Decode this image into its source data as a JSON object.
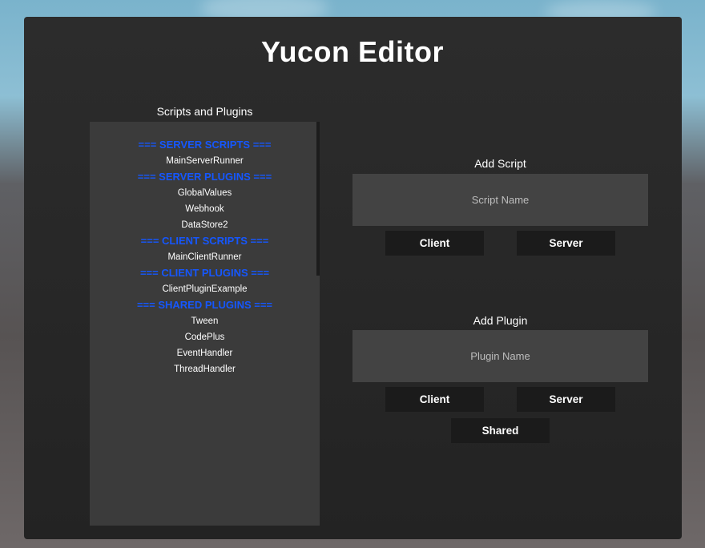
{
  "window": {
    "title": "Yucon Editor"
  },
  "list": {
    "label": "Scripts and Plugins",
    "items": [
      {
        "text": "=== SERVER SCRIPTS ===",
        "header": true
      },
      {
        "text": "MainServerRunner",
        "header": false
      },
      {
        "text": "=== SERVER PLUGINS ===",
        "header": true
      },
      {
        "text": "GlobalValues",
        "header": false
      },
      {
        "text": "Webhook",
        "header": false
      },
      {
        "text": "DataStore2",
        "header": false
      },
      {
        "text": "=== CLIENT SCRIPTS ===",
        "header": true
      },
      {
        "text": "MainClientRunner",
        "header": false
      },
      {
        "text": "=== CLIENT PLUGINS ===",
        "header": true
      },
      {
        "text": "ClientPluginExample",
        "header": false
      },
      {
        "text": "=== SHARED PLUGINS ===",
        "header": true
      },
      {
        "text": "Tween",
        "header": false
      },
      {
        "text": "CodePlus",
        "header": false
      },
      {
        "text": "EventHandler",
        "header": false
      },
      {
        "text": "ThreadHandler",
        "header": false
      }
    ]
  },
  "add_script": {
    "label": "Add Script",
    "placeholder": "Script Name",
    "client_label": "Client",
    "server_label": "Server"
  },
  "add_plugin": {
    "label": "Add Plugin",
    "placeholder": "Plugin Name",
    "client_label": "Client",
    "server_label": "Server",
    "shared_label": "Shared"
  },
  "colors": {
    "header_text": "#1557ff",
    "panel_bg": "#262626",
    "list_bg": "#3b3b3b",
    "input_bg": "#434343",
    "button_bg": "#1b1b1b"
  }
}
